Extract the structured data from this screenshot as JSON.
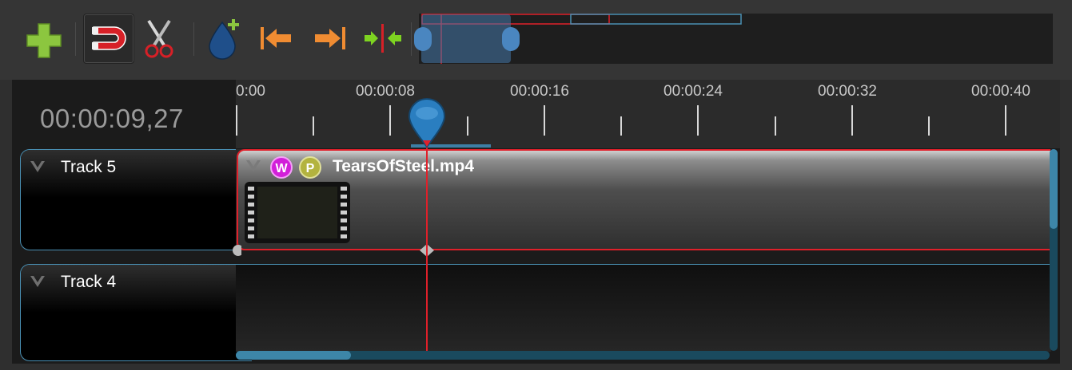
{
  "toolbar": {
    "buttons": [
      {
        "icon": "plus-icon",
        "label": ""
      },
      {
        "icon": "magnet-icon",
        "label": "",
        "active": true
      },
      {
        "icon": "scissors-icon",
        "label": ""
      },
      {
        "icon": "add-marker-icon",
        "label": ""
      },
      {
        "icon": "jump-previous-icon",
        "label": ""
      },
      {
        "icon": "jump-next-icon",
        "label": ""
      },
      {
        "icon": "center-playhead-icon",
        "label": ""
      }
    ],
    "colors": {
      "plus": "#8cc63f",
      "magnet": "#d72027",
      "arrows": "#f08c32",
      "center": "#7ed321"
    }
  },
  "timeline": {
    "current_time": "00:00:09,27",
    "ruler_labels": [
      "0:00",
      "00:00:08",
      "00:00:16",
      "00:00:24",
      "00:00:32",
      "00:00:40"
    ],
    "tracks": [
      {
        "name": "Track 5"
      },
      {
        "name": "Track 4"
      }
    ],
    "clip": {
      "title": "TearsOfSteel.mp4",
      "badges": [
        "W",
        "P"
      ],
      "selected_color": "#e0202a"
    },
    "accent_color": "#4a90b4"
  }
}
